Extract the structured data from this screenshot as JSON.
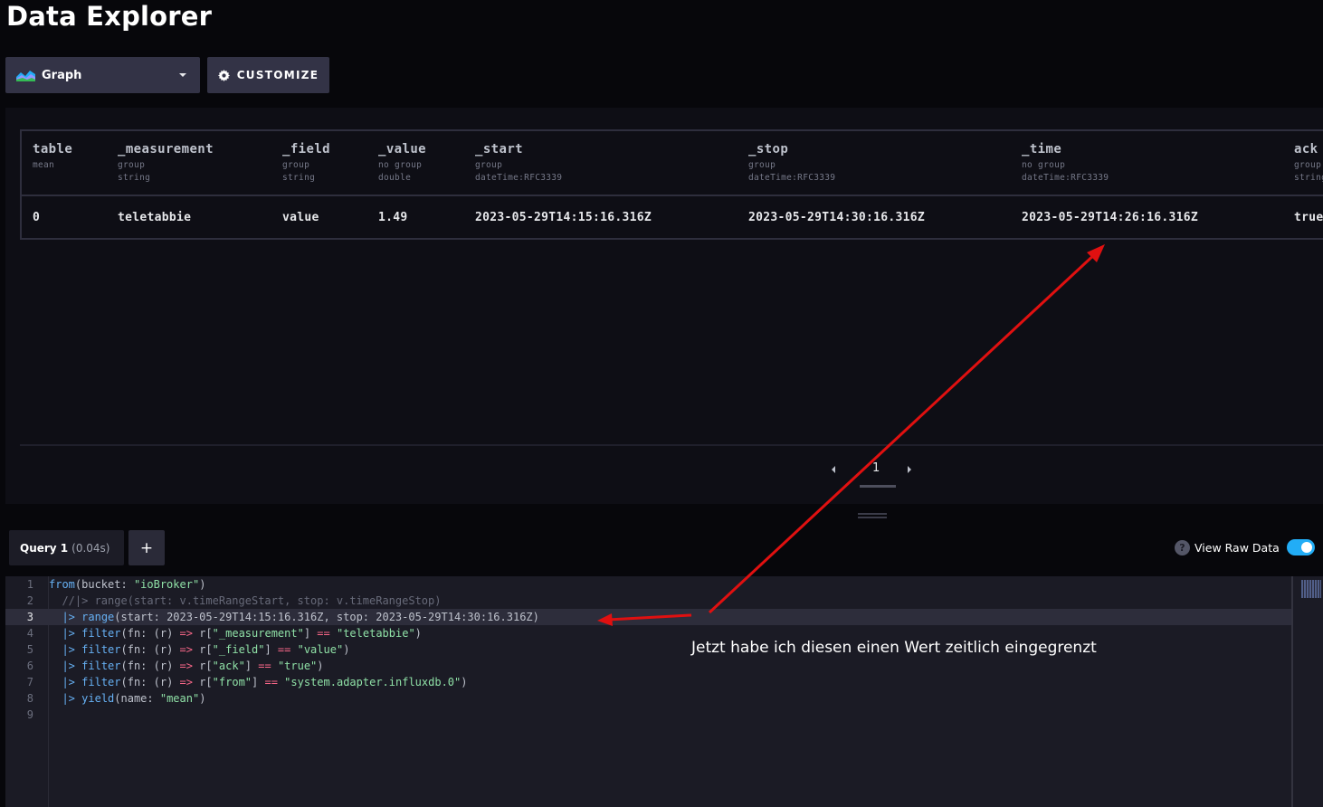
{
  "page": {
    "title": "Data Explorer"
  },
  "toolbar": {
    "view_type": "Graph",
    "customize_label": "CUSTOMIZE"
  },
  "table": {
    "columns": [
      {
        "name": "table",
        "group": "mean",
        "type": ""
      },
      {
        "name": "_measurement",
        "group": "group",
        "type": "string"
      },
      {
        "name": "_field",
        "group": "group",
        "type": "string"
      },
      {
        "name": "_value",
        "group": "no group",
        "type": "double"
      },
      {
        "name": "_start",
        "group": "group",
        "type": "dateTime:RFC3339"
      },
      {
        "name": "_stop",
        "group": "group",
        "type": "dateTime:RFC3339"
      },
      {
        "name": "_time",
        "group": "no group",
        "type": "dateTime:RFC3339"
      },
      {
        "name": "ack",
        "group": "group",
        "type": "string"
      }
    ],
    "rows": [
      [
        "0",
        "teletabbie",
        "value",
        "1.49",
        "2023-05-29T14:15:16.316Z",
        "2023-05-29T14:30:16.316Z",
        "2023-05-29T14:26:16.316Z",
        "true"
      ]
    ]
  },
  "pagination": {
    "current_page": "1"
  },
  "query": {
    "tab_name": "Query 1",
    "tab_time": "(0.04s)",
    "add_label": "+",
    "view_raw_label": "View Raw Data",
    "help_label": "?",
    "view_raw_enabled": true
  },
  "editor": {
    "line_numbers": [
      "1",
      "2",
      "3",
      "4",
      "5",
      "6",
      "7",
      "8",
      "9"
    ],
    "line1": {
      "fn": "from",
      "a": "(bucket: ",
      "s": "\"ioBroker\"",
      "b": ")"
    },
    "line2": {
      "comment": "//|> range(start: v.timeRangeStart, stop: v.timeRangeStop)"
    },
    "line3": {
      "pipe": "|>",
      "fn": "range",
      "rest": "(start: 2023-05-29T14:15:16.316Z, stop: 2023-05-29T14:30:16.316Z)"
    },
    "line4": {
      "pipe": "|>",
      "fn": "filter",
      "a": "(fn: (r) ",
      "arrow": "=>",
      "b": " r[",
      "key": "\"_measurement\"",
      "c": "] ",
      "eq": "==",
      "d": " ",
      "val": "\"teletabbie\"",
      "e": ")"
    },
    "line5": {
      "pipe": "|>",
      "fn": "filter",
      "a": "(fn: (r) ",
      "arrow": "=>",
      "b": " r[",
      "key": "\"_field\"",
      "c": "] ",
      "eq": "==",
      "d": " ",
      "val": "\"value\"",
      "e": ")"
    },
    "line6": {
      "pipe": "|>",
      "fn": "filter",
      "a": "(fn: (r) ",
      "arrow": "=>",
      "b": " r[",
      "key": "\"ack\"",
      "c": "] ",
      "eq": "==",
      "d": " ",
      "val": "\"true\"",
      "e": ")"
    },
    "line7": {
      "pipe": "|>",
      "fn": "filter",
      "a": "(fn: (r) ",
      "arrow": "=>",
      "b": " r[",
      "key": "\"from\"",
      "c": "] ",
      "eq": "==",
      "d": " ",
      "val": "\"system.adapter.influxdb.0\"",
      "e": ")"
    },
    "line8": {
      "pipe": "|>",
      "fn": "yield",
      "a": "(name: ",
      "s": "\"mean\"",
      "b": ")"
    }
  },
  "annotation": {
    "text": "Jetzt habe ich diesen einen Wert zeitlich eingegrenzt",
    "color": "#e01010"
  }
}
